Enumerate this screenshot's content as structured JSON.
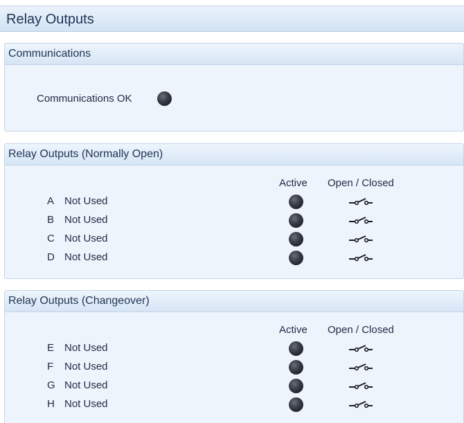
{
  "window": {
    "title": "Relay Outputs"
  },
  "communications": {
    "section_title": "Communications",
    "status_label": "Communications OK",
    "status_icon": "status-led-icon"
  },
  "normally_open": {
    "section_title": "Relay Outputs (Normally Open)",
    "columns": {
      "active": "Active",
      "open_closed": "Open / Closed"
    },
    "rows": [
      {
        "letter": "A",
        "label": "Not Used",
        "switch_icon": "relay-switch-icon"
      },
      {
        "letter": "B",
        "label": "Not Used",
        "switch_icon": "relay-switch-icon"
      },
      {
        "letter": "C",
        "label": "Not Used",
        "switch_icon": "relay-switch-icon"
      },
      {
        "letter": "D",
        "label": "Not Used",
        "switch_icon": "relay-switch-icon"
      }
    ]
  },
  "changeover": {
    "section_title": "Relay Outputs (Changeover)",
    "columns": {
      "active": "Active",
      "open_closed": "Open / Closed"
    },
    "rows": [
      {
        "letter": "E",
        "label": "Not Used",
        "switch_icon": "relay-switch-icon"
      },
      {
        "letter": "F",
        "label": "Not Used",
        "switch_icon": "relay-switch-icon"
      },
      {
        "letter": "G",
        "label": "Not Used",
        "switch_icon": "relay-switch-icon"
      },
      {
        "letter": "H",
        "label": "Not Used",
        "switch_icon": "relay-switch-icon"
      }
    ]
  },
  "colors": {
    "header_gradient_top": "#eaf2fb",
    "header_gradient_bottom": "#d3e3f3",
    "panel_background": "#eef4fc",
    "led_off": "#2a2d35",
    "text": "#1f2a44"
  }
}
